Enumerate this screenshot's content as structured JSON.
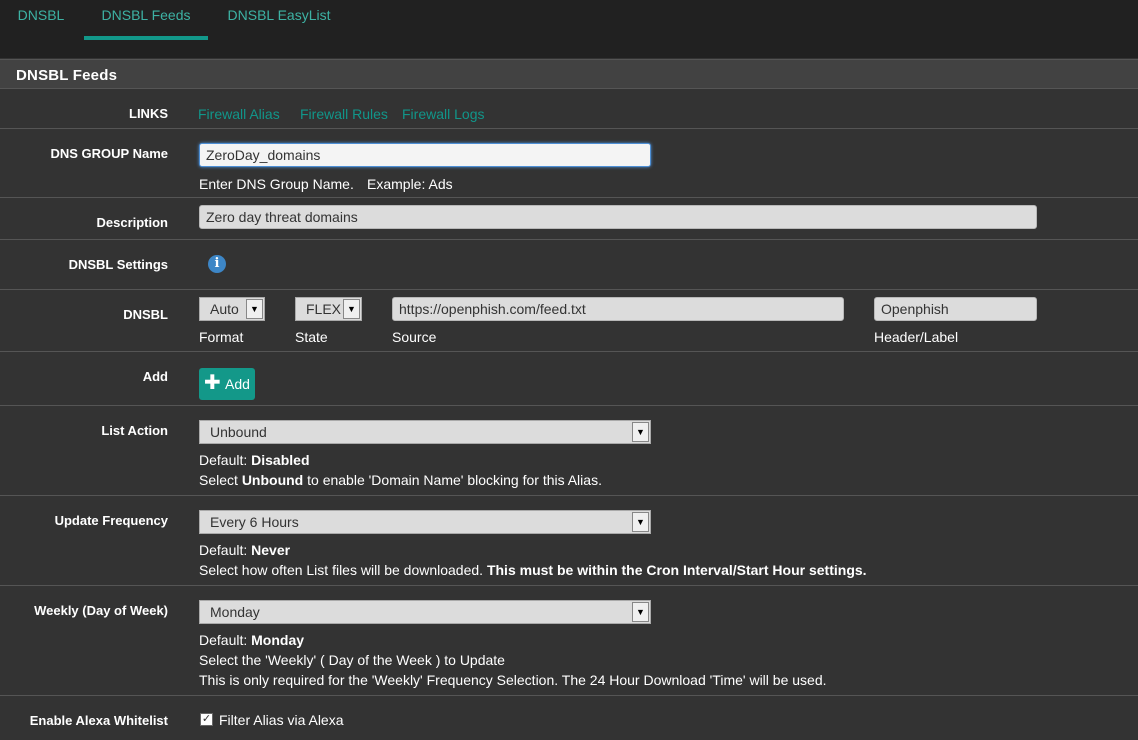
{
  "tabs": [
    {
      "label": "DNSBL"
    },
    {
      "label": "DNSBL Feeds",
      "active": true
    },
    {
      "label": "DNSBL EasyList"
    }
  ],
  "panel": {
    "title": "DNSBL Feeds"
  },
  "links": {
    "label": "LINKS",
    "items": [
      "Firewall Alias",
      "Firewall Rules",
      "Firewall Logs"
    ]
  },
  "dns_group": {
    "label": "DNS GROUP Name",
    "value": "ZeroDay_domains",
    "help": "Enter DNS Group Name.",
    "example": "Example: Ads"
  },
  "description": {
    "label": "Description",
    "value": "Zero day threat domains"
  },
  "dnsbl_settings": {
    "label": "DNSBL Settings",
    "icon": "info-icon"
  },
  "dnsbl": {
    "label": "DNSBL",
    "format": {
      "value": "Auto",
      "caption": "Format"
    },
    "state": {
      "value": "FLEX",
      "caption": "State"
    },
    "source": {
      "value": "https://openphish.com/feed.txt",
      "caption": "Source"
    },
    "header": {
      "value": "Openphish",
      "caption": "Header/Label"
    }
  },
  "add": {
    "label": "Add",
    "button": "Add",
    "icon": "plus-icon"
  },
  "list_action": {
    "label": "List Action",
    "value": "Unbound",
    "default_prefix": "Default:",
    "default_value": "Disabled",
    "help_pre": "Select",
    "help_bold": "Unbound",
    "help_post": "to enable 'Domain Name' blocking for this Alias."
  },
  "update_frequency": {
    "label": "Update Frequency",
    "value": "Every 6 Hours",
    "default_prefix": "Default:",
    "default_value": "Never",
    "help_pre": "Select how often List files will be downloaded.",
    "help_bold": "This must be within the Cron Interval/Start Hour settings."
  },
  "weekly": {
    "label": "Weekly (Day of Week)",
    "value": "Monday",
    "default_prefix": "Default:",
    "default_value": "Monday",
    "help_1": "Select the 'Weekly' ( Day of the Week ) to Update",
    "help_2": "This is only required for the 'Weekly' Frequency Selection. The 24 Hour Download 'Time' will be used."
  },
  "alexa": {
    "label": "Enable Alexa Whitelist",
    "checkbox_label": "Filter Alias via Alexa",
    "checked": true
  },
  "colors": {
    "accent": "#12988a",
    "link": "#3db2a4",
    "background": "#333333",
    "tabbar": "#212121",
    "info": "#3d86c6"
  }
}
